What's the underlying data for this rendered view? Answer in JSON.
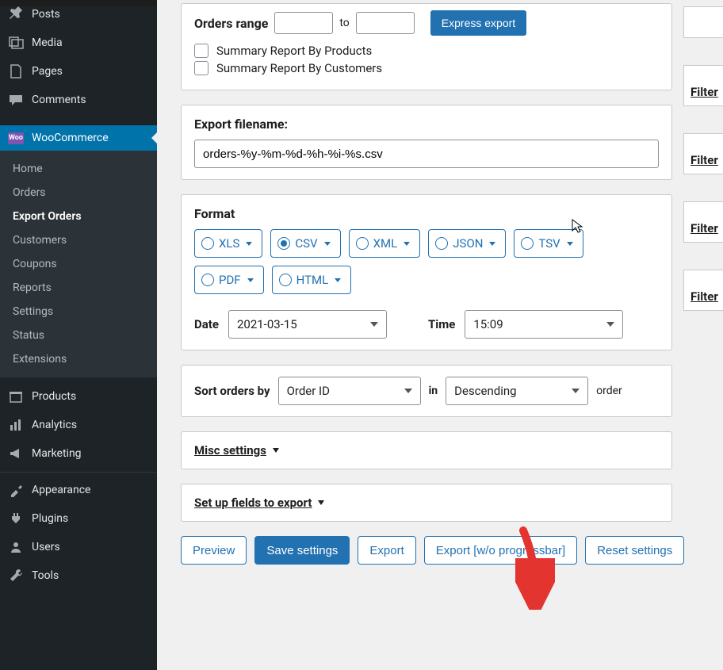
{
  "sidebar": {
    "items": [
      {
        "label": "Posts"
      },
      {
        "label": "Media"
      },
      {
        "label": "Pages"
      },
      {
        "label": "Comments"
      }
    ],
    "woo": {
      "label": "WooCommerce"
    },
    "submenu": [
      "Home",
      "Orders",
      "Export Orders",
      "Customers",
      "Coupons",
      "Reports",
      "Settings",
      "Status",
      "Extensions"
    ],
    "after": [
      {
        "label": "Products"
      },
      {
        "label": "Analytics"
      },
      {
        "label": "Marketing"
      }
    ],
    "tools": [
      {
        "label": "Appearance"
      },
      {
        "label": "Plugins"
      },
      {
        "label": "Users"
      },
      {
        "label": "Tools"
      }
    ]
  },
  "orders": {
    "label": "Orders range",
    "to": "to",
    "express": "Express export",
    "cb1": "Summary Report By Products",
    "cb2": "Summary Report By Customers"
  },
  "filename": {
    "heading": "Export filename:",
    "value": "orders-%y-%m-%d-%h-%i-%s.csv"
  },
  "format": {
    "heading": "Format",
    "opts": [
      "XLS",
      "CSV",
      "XML",
      "JSON",
      "TSV",
      "PDF",
      "HTML"
    ],
    "dateLabel": "Date",
    "dateVal": "2021-03-15",
    "timeLabel": "Time",
    "timeVal": "15:09"
  },
  "sort": {
    "label": "Sort orders by",
    "field": "Order ID",
    "in": "in",
    "dir": "Descending",
    "order": "order"
  },
  "misc": "Misc settings",
  "setup": "Set up fields to export",
  "actions": {
    "preview": "Preview",
    "save": "Save settings",
    "export": "Export",
    "exportNo": "Export [w/o progressbar]",
    "reset": "Reset settings"
  },
  "peek": "Filter",
  "wooBadge": "Woo"
}
